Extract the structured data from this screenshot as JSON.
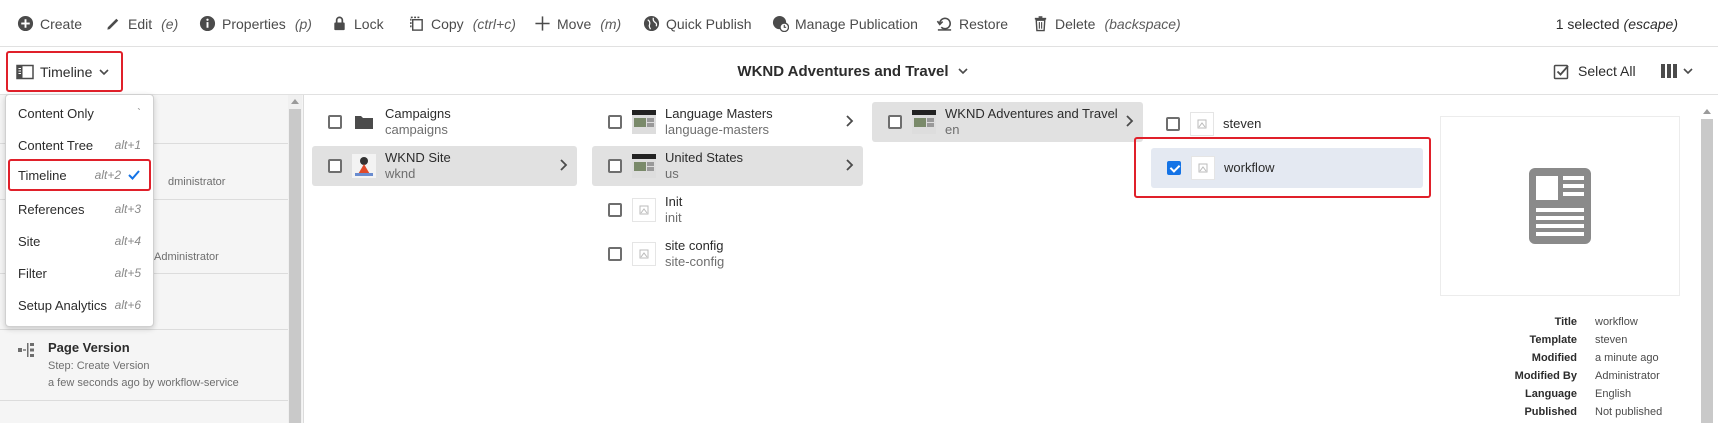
{
  "actionbar": {
    "create": "Create",
    "edit": "Edit",
    "edit_shortcut": "(e)",
    "properties": "Properties",
    "properties_shortcut": "(p)",
    "lock": "Lock",
    "copy": "Copy",
    "copy_shortcut": "(ctrl+c)",
    "move": "Move",
    "move_shortcut": "(m)",
    "quick_publish": "Quick Publish",
    "manage_publication": "Manage Publication",
    "restore": "Restore",
    "delete": "Delete",
    "delete_shortcut": "(backspace)",
    "selected_text": "1 selected",
    "selected_shortcut": "(escape)"
  },
  "viewbar": {
    "rail_label": "Timeline",
    "title": "WKND Adventures and Travel",
    "select_all": "Select All"
  },
  "rail_menu": {
    "items": [
      {
        "label": "Content Only",
        "shortcut": "`"
      },
      {
        "label": "Content Tree",
        "shortcut": "alt+1"
      },
      {
        "label": "Timeline",
        "shortcut": "alt+2",
        "selected": true
      },
      {
        "label": "References",
        "shortcut": "alt+3"
      },
      {
        "label": "Site",
        "shortcut": "alt+4"
      },
      {
        "label": "Filter",
        "shortcut": "alt+5"
      },
      {
        "label": "Setup Analytics",
        "shortcut": "alt+6"
      }
    ]
  },
  "rail": {
    "partial_1": "dministrator",
    "partial_2": "Administrator",
    "version_title": "Page Version",
    "version_step": "Step: Create Version",
    "version_when": "a few seconds ago by workflow-service"
  },
  "columns": {
    "col1": [
      {
        "title": "Campaigns",
        "name": "campaigns",
        "icon": "folder-icon"
      },
      {
        "title": "WKND Site",
        "name": "wknd",
        "icon": "site-thumbnail",
        "selected": true
      }
    ],
    "col2": [
      {
        "title": "Language Masters",
        "name": "language-masters",
        "icon": "page-thumbnail"
      },
      {
        "title": "United States",
        "name": "us",
        "icon": "page-thumbnail",
        "selected": true
      },
      {
        "title": "Init",
        "name": "init",
        "icon": "page-placeholder-icon"
      },
      {
        "title": "site config",
        "name": "site-config",
        "icon": "page-placeholder-icon"
      }
    ],
    "col3": [
      {
        "title": "WKND Adventures and Travel",
        "name": "en",
        "icon": "page-thumbnail",
        "selected": true
      }
    ],
    "col4": [
      {
        "title": "steven",
        "icon": "page-placeholder-icon"
      },
      {
        "title": "workflow",
        "icon": "page-placeholder-icon",
        "checked": true
      }
    ]
  },
  "preview": {
    "labels": {
      "title": "Title",
      "template": "Template",
      "modified": "Modified",
      "modified_by": "Modified By",
      "language": "Language",
      "published": "Published"
    },
    "values": {
      "title": "workflow",
      "template": "steven",
      "modified": "a minute ago",
      "modified_by": "Administrator",
      "language": "English",
      "published": "Not published"
    }
  },
  "colors": {
    "accent": "#1473e6",
    "highlight_border": "#e0202a",
    "selected_row": "#e1e1e1"
  }
}
